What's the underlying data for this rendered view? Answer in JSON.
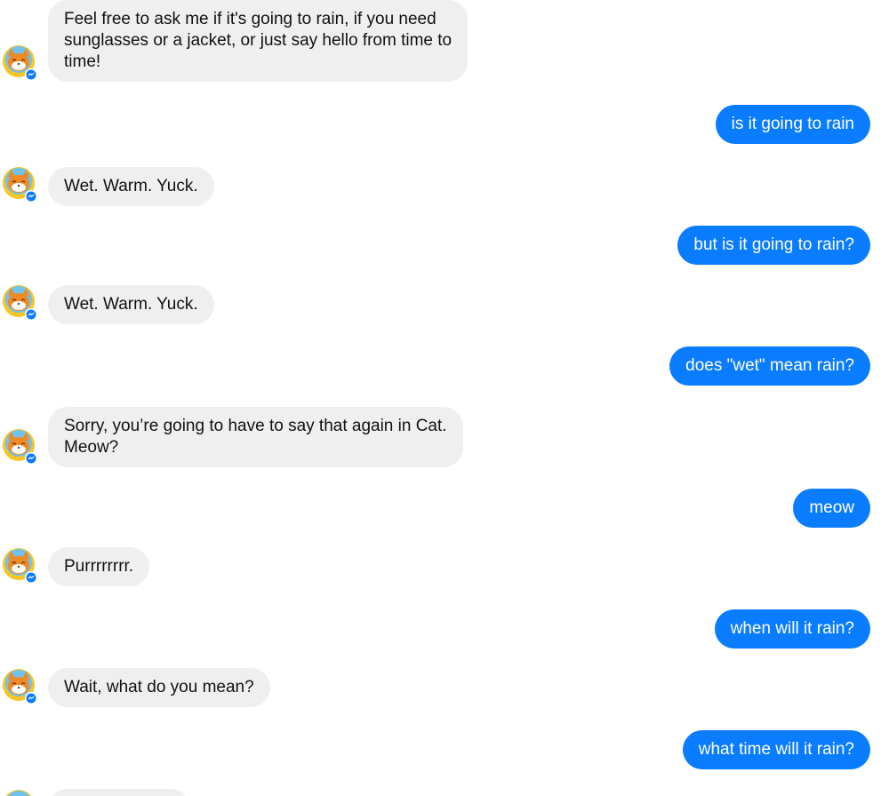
{
  "messages": [
    {
      "from": "bot",
      "text": "Feel free to ask me if it's going to rain, if you need\nsunglasses or a jacket, or just say hello from time to\ntime!"
    },
    {
      "from": "user",
      "text": "is it going to rain"
    },
    {
      "from": "bot",
      "text": "Wet. Warm. Yuck."
    },
    {
      "from": "user",
      "text": "but is it going to rain?"
    },
    {
      "from": "bot",
      "text": "Wet. Warm. Yuck."
    },
    {
      "from": "user",
      "text": "does \"wet\" mean rain?"
    },
    {
      "from": "bot",
      "text": "Sorry, you’re going to have to say that again in Cat.\nMeow?"
    },
    {
      "from": "user",
      "text": "meow"
    },
    {
      "from": "bot",
      "text": "Purrrrrrrr."
    },
    {
      "from": "user",
      "text": "when will it rain?"
    },
    {
      "from": "bot",
      "text": "Wait, what do you mean?"
    },
    {
      "from": "user",
      "text": "what time will it rain?"
    }
  ],
  "avatar_icon": "cat-bot-avatar-icon",
  "badge_icon": "messenger-badge-icon",
  "colors": {
    "bot_bubble": "#f0eff0",
    "user_bubble": "#0a7cff",
    "bot_text": "#111111",
    "user_text": "#ffffff"
  }
}
